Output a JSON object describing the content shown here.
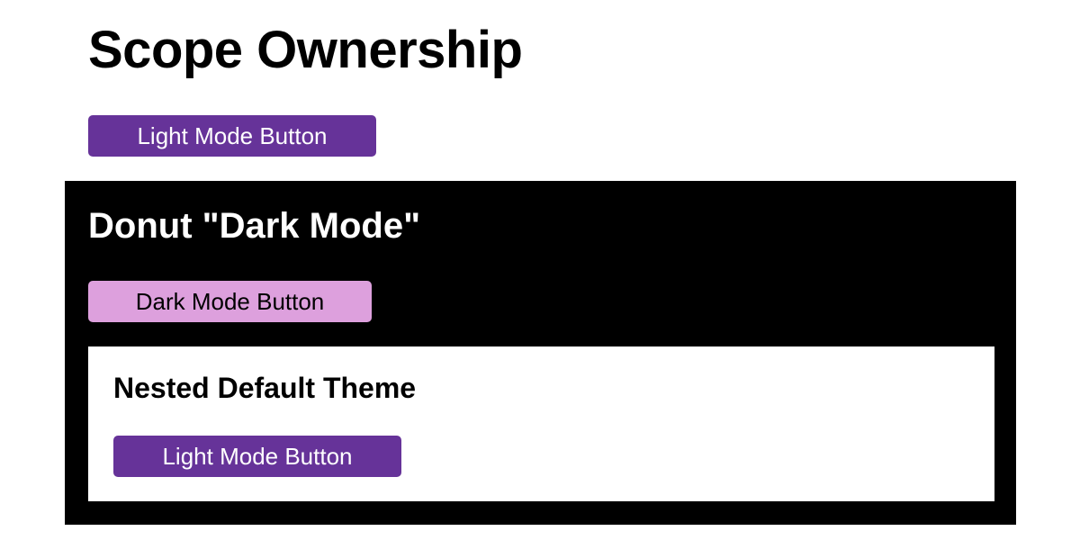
{
  "page": {
    "title": "Scope Ownership"
  },
  "top_section": {
    "button_label": "Light Mode Button"
  },
  "dark_section": {
    "title": "Donut \"Dark Mode\"",
    "button_label": "Dark Mode Button"
  },
  "nested_section": {
    "title": "Nested Default Theme",
    "button_label": "Light Mode Button"
  },
  "colors": {
    "light_button_bg": "#663399",
    "light_button_text": "#ffffff",
    "dark_button_bg": "#dda0dd",
    "dark_button_text": "#000000",
    "dark_section_bg": "#000000",
    "nested_section_bg": "#ffffff"
  }
}
